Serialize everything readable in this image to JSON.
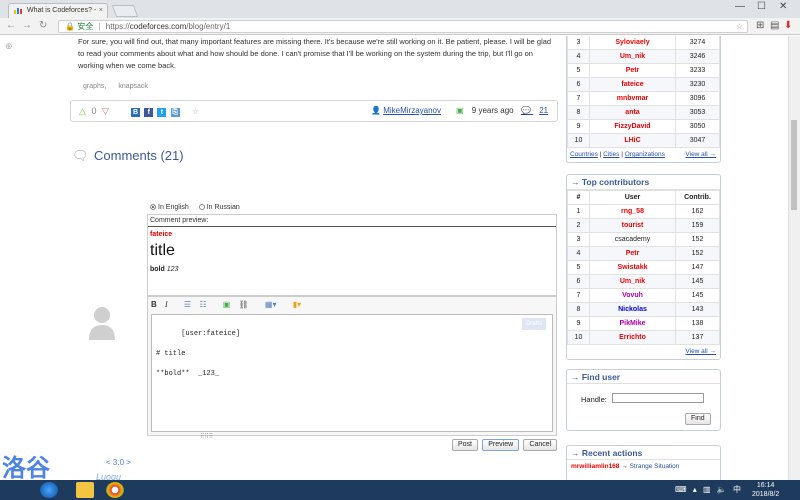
{
  "browser": {
    "tab_title": "What is Codeforces? -",
    "tab_close": "×",
    "secure_label": "安全",
    "url_scheme": "https://",
    "url_host": "codeforces.com",
    "url_path": "/blog/entry/1",
    "window_min": "—",
    "window_max": "☐",
    "window_close": "✕"
  },
  "article": {
    "text": "For sure, you will find out, that many important features are missing there. It's because we're still working on it. Be patient, please. I will be glad to read your comments about what and how should be done. I can't promise that I'll be working on the system during the trip, but I'll go on working when we come back.",
    "tags": [
      "graphs,",
      "knapsack"
    ],
    "rating": "0",
    "author": "MikeMirzayanov",
    "age": "9 years ago",
    "comment_count": "21"
  },
  "comments": {
    "title": "Comments (21)",
    "lang_en": "In English",
    "lang_ru": "In Russian",
    "preview_label": "Comment preview:",
    "preview_user": "fateice",
    "preview_title": "title",
    "preview_bold": "bold",
    "preview_italic": " 123",
    "editor_text": "[user:fateice]\n\n# title\n\n**bold**  _123_",
    "draft_label": "Drafts",
    "post": "Post",
    "preview": "Preview",
    "cancel": "Cancel"
  },
  "rating_table": {
    "rows": [
      {
        "rank": "3",
        "user": "Syloviaely",
        "val": "3274",
        "cls": "r-legend"
      },
      {
        "rank": "4",
        "user": "Um_nik",
        "val": "3246",
        "cls": "r-legend"
      },
      {
        "rank": "5",
        "user": "Petr",
        "val": "3233",
        "cls": "r-legend"
      },
      {
        "rank": "6",
        "user": "fateice",
        "val": "3230",
        "cls": "r-legend"
      },
      {
        "rank": "7",
        "user": "mnbvmar",
        "val": "3096",
        "cls": "r-legend"
      },
      {
        "rank": "8",
        "user": "anta",
        "val": "3053",
        "cls": "r-legend"
      },
      {
        "rank": "9",
        "user": "FizzyDavid",
        "val": "3050",
        "cls": "r-legend"
      },
      {
        "rank": "10",
        "user": "LHiC",
        "val": "3047",
        "cls": "r-legend"
      }
    ],
    "footer_countries": "Countries",
    "footer_cities": "Cities",
    "footer_orgs": "Organizations",
    "view_all": "View all →"
  },
  "contributors": {
    "title": "→ Top contributors",
    "h_rank": "#",
    "h_user": "User",
    "h_contrib": "Contrib.",
    "rows": [
      {
        "rank": "1",
        "user": "rng_58",
        "val": "162",
        "cls": "r-red"
      },
      {
        "rank": "2",
        "user": "tourist",
        "val": "159",
        "cls": "r-red"
      },
      {
        "rank": "3",
        "user": "csacademy",
        "val": "152",
        "cls": "r-black"
      },
      {
        "rank": "4",
        "user": "Petr",
        "val": "152",
        "cls": "r-red"
      },
      {
        "rank": "5",
        "user": "Swistakk",
        "val": "147",
        "cls": "r-red"
      },
      {
        "rank": "6",
        "user": "Um_nik",
        "val": "145",
        "cls": "r-red"
      },
      {
        "rank": "7",
        "user": "Vovuh",
        "val": "145",
        "cls": "r-violet"
      },
      {
        "rank": "8",
        "user": "Nickolas",
        "val": "143",
        "cls": "r-blue"
      },
      {
        "rank": "9",
        "user": "PikMike",
        "val": "138",
        "cls": "r-violet"
      },
      {
        "rank": "10",
        "user": "Errichto",
        "val": "137",
        "cls": "r-red"
      }
    ],
    "view_all": "View all →"
  },
  "find_user": {
    "title": "→ Find user",
    "handle_label": "Handle:",
    "find_btn": "Find"
  },
  "recent": {
    "title": "→ Recent actions",
    "user": "mrwilliamlin168",
    "arrow": " → ",
    "topic": "Strange Situation"
  },
  "watermark": {
    "brand": "洛谷",
    "version": "< 3.0 >",
    "sub": "Luogu"
  },
  "taskbar": {
    "time": "16:14",
    "date": "2018/8/2",
    "tray_lang": "中"
  }
}
